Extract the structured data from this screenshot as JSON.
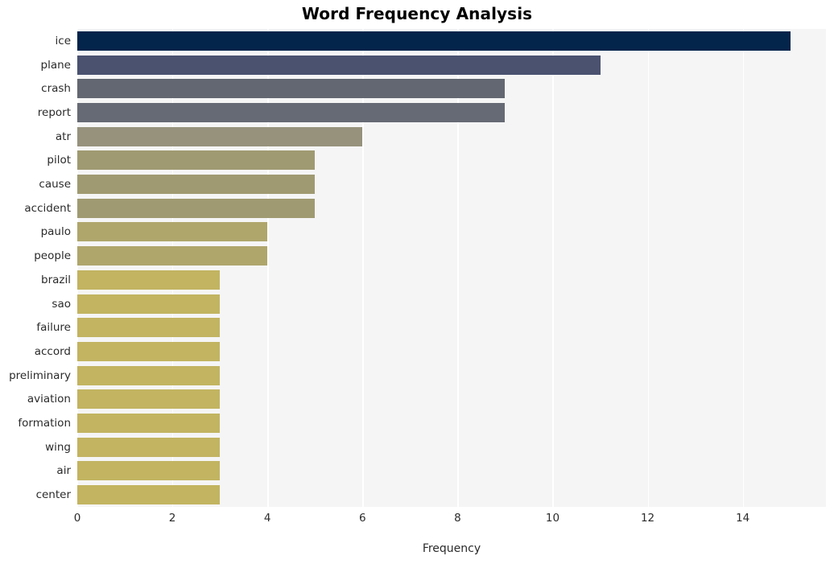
{
  "chart_data": {
    "type": "bar",
    "orientation": "horizontal",
    "title": "Word Frequency Analysis",
    "xlabel": "Frequency",
    "ylabel": "",
    "categories": [
      "ice",
      "plane",
      "crash",
      "report",
      "atr",
      "pilot",
      "cause",
      "accident",
      "paulo",
      "people",
      "brazil",
      "sao",
      "failure",
      "accord",
      "preliminary",
      "aviation",
      "formation",
      "wing",
      "air",
      "center"
    ],
    "values": [
      15,
      11,
      9,
      9,
      6,
      5,
      5,
      5,
      4,
      4,
      3,
      3,
      3,
      3,
      3,
      3,
      3,
      3,
      3,
      3
    ],
    "bar_colors": [
      "#03244b",
      "#4a5270",
      "#626771",
      "#666a74",
      "#96927c",
      "#a09a72",
      "#a09a72",
      "#a09a72",
      "#afa66c",
      "#afa66c",
      "#c2b461",
      "#c2b461",
      "#c2b461",
      "#c2b461",
      "#c2b461",
      "#c2b461",
      "#c2b461",
      "#c2b461",
      "#c2b461",
      "#c2b461"
    ],
    "xlim": [
      0,
      15.75
    ],
    "xticks": [
      0,
      2,
      4,
      6,
      8,
      10,
      12,
      14
    ],
    "xticklabels": [
      "0",
      "2",
      "4",
      "6",
      "8",
      "10",
      "12",
      "14"
    ],
    "grid": true,
    "grid_axis": "x",
    "grid_color": "#ffffff",
    "plot_background": "#f5f5f6",
    "figure_background": "#ffffff",
    "legend": null
  }
}
